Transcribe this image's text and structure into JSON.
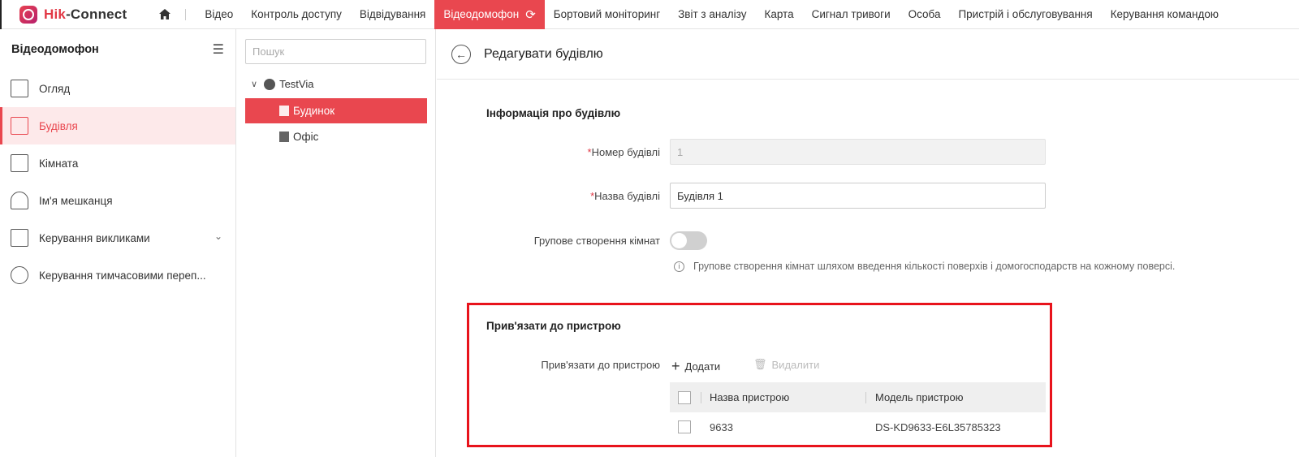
{
  "app": {
    "brand_red": "Hik",
    "brand_rest": "-Connect",
    "accent": "#e9474f"
  },
  "menu": [
    {
      "label": "Відео"
    },
    {
      "label": "Контроль доступу"
    },
    {
      "label": "Відвідування"
    },
    {
      "label": "Відеодомофон",
      "active": true
    },
    {
      "label": "Бортовий моніторинг"
    },
    {
      "label": "Звіт з аналізу"
    },
    {
      "label": "Карта"
    },
    {
      "label": "Сигнал тривоги"
    },
    {
      "label": "Особа"
    },
    {
      "label": "Пристрій і обслуговування"
    },
    {
      "label": "Керування командою"
    }
  ],
  "sidebar": {
    "title": "Відеодомофон",
    "items": [
      {
        "label": "Огляд",
        "icon": "overview-icon"
      },
      {
        "label": "Будівля",
        "icon": "building-icon",
        "active": true
      },
      {
        "label": "Кімната",
        "icon": "room-icon"
      },
      {
        "label": "Ім'я мешканця",
        "icon": "resident-icon"
      },
      {
        "label": "Керування викликами",
        "icon": "call-icon"
      },
      {
        "label": "Керування тимчасовими переп...",
        "icon": "temp-pass-icon"
      }
    ]
  },
  "tree": {
    "search_placeholder": "Пошук",
    "root": "TestVia",
    "nodes": [
      {
        "label": "Будинок",
        "active": true
      },
      {
        "label": "Офіс"
      }
    ]
  },
  "main": {
    "title": "Редагувати будівлю",
    "section_info": "Інформація про будівлю",
    "building_number_label": "Номер будівлі",
    "building_number_value": "1",
    "building_name_label": "Назва будівлі",
    "building_name_value": "Будівля 1",
    "group_create_label": "Групове створення кімнат",
    "group_create_on": false,
    "hint": "Групове створення кімнат шляхом введення кількості поверхів і домогосподарств на кожному поверсі.",
    "section_link": "Прив'язати до пристрою",
    "link_label": "Прив'язати до пристрою",
    "add_label": "Додати",
    "delete_label": "Видалити",
    "table": {
      "headers": [
        "Назва пристрою",
        "Модель пристрою"
      ],
      "rows": [
        {
          "name": "9633",
          "model": "DS-KD9633-E6L35785323"
        }
      ]
    }
  }
}
